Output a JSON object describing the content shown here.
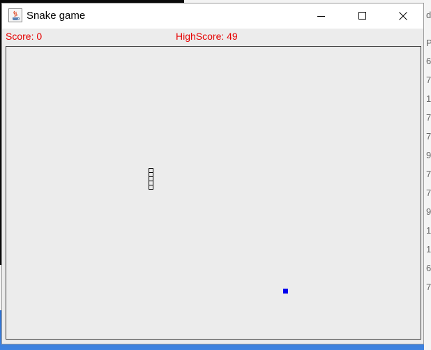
{
  "window": {
    "title": "Snake game",
    "icon": "java-coffee-cup-icon",
    "controls": [
      "minimize-icon",
      "maximize-icon",
      "close-icon"
    ]
  },
  "scoreboard": {
    "score_text": "Score: 0",
    "highscore_text": "HighScore: 49",
    "text_color": "#e60000"
  },
  "game": {
    "board_background": "#ececec",
    "board_border": "#3a3a3a",
    "snake": {
      "segment_count": 5,
      "direction": "vertical",
      "segment_fill": "#ececec",
      "segment_outline": "#000000"
    },
    "food": {
      "color": "#0000ee"
    }
  },
  "background": {
    "right_panel_rows": [
      "d",
      "P",
      "6",
      "7",
      "1",
      "7",
      "7",
      "9",
      "7",
      "7",
      "9",
      "1",
      "1",
      "6",
      "7"
    ]
  }
}
